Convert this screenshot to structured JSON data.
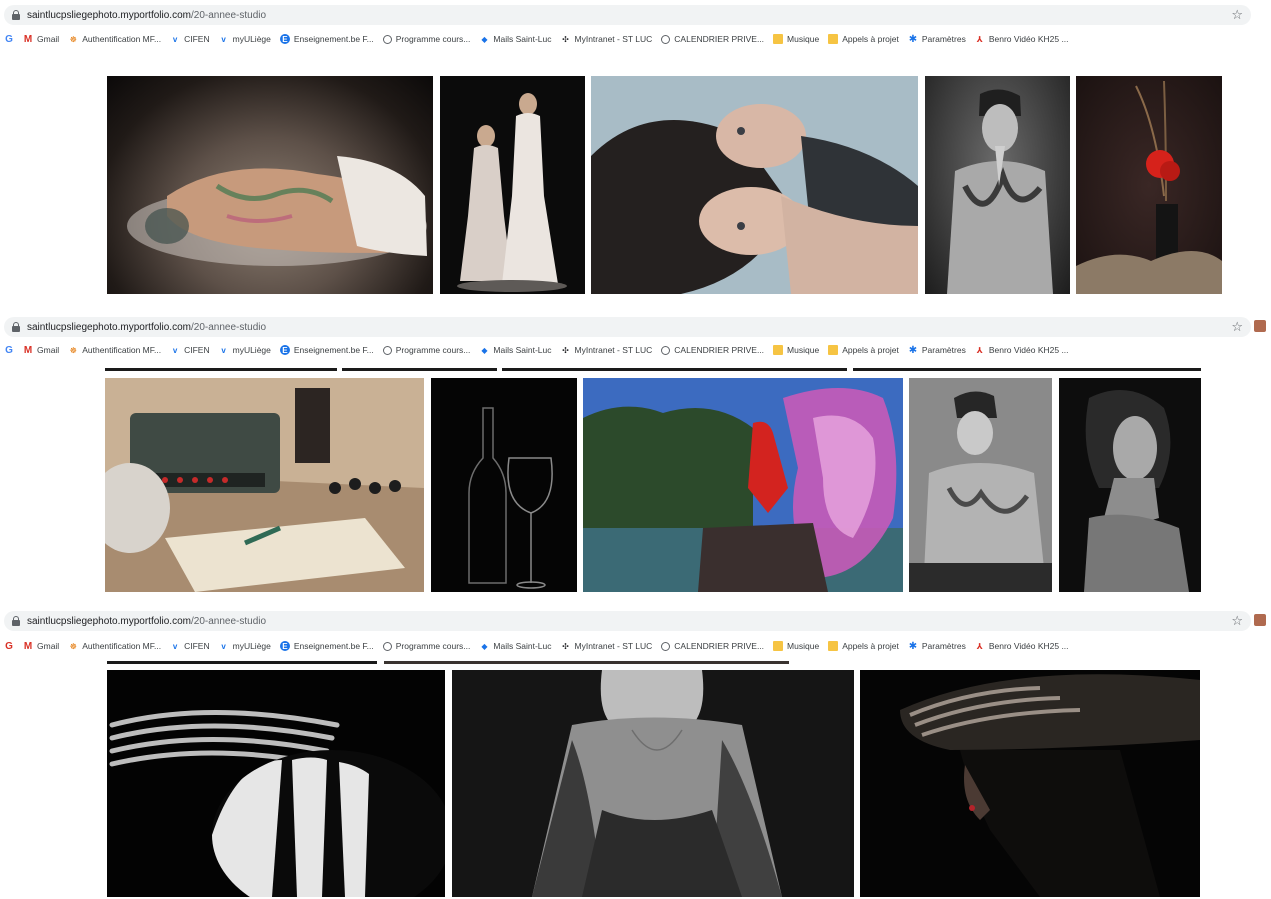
{
  "browser": {
    "url_host": "saintlucpsliegephoto.myportfolio.com",
    "url_path": "/20-annee-studio",
    "bookmarks": [
      {
        "label": "Gmail",
        "icon": "gmail-icon"
      },
      {
        "label": "Authentification MF...",
        "icon": "auth-icon"
      },
      {
        "label": "CIFEN",
        "icon": "uliege-icon"
      },
      {
        "label": "myULiège",
        "icon": "uliege-icon"
      },
      {
        "label": "Enseignement.be F...",
        "icon": "enseignement-icon"
      },
      {
        "label": "Programme cours...",
        "icon": "globe-icon"
      },
      {
        "label": "Mails Saint-Luc",
        "icon": "mail-icon"
      },
      {
        "label": "MyIntranet - ST LUC",
        "icon": "network-icon"
      },
      {
        "label": "CALENDRIER PRIVE...",
        "icon": "globe-icon"
      },
      {
        "label": "Musique",
        "icon": "folder-icon"
      },
      {
        "label": "Appels à projet",
        "icon": "folder-icon"
      },
      {
        "label": "Paramètres",
        "icon": "gear-icon"
      },
      {
        "label": "Benro Vidéo KH25 ...",
        "icon": "benro-icon"
      }
    ]
  },
  "screens": [
    {
      "photos": [
        "reclining-tattooed-figure",
        "two-women-white-dresses",
        "two-faces-lying",
        "tattooed-man-hand-face",
        "red-poppy-vase"
      ]
    },
    {
      "photos": [
        "typewriter-still-life",
        "wine-bottle-glass",
        "red-figure-pink-smoke",
        "tattooed-man-seated",
        "woman-portrait-bw"
      ]
    },
    {
      "photos": [
        "fork-striped-egg",
        "woman-lace-top",
        "woman-striped-hat"
      ]
    }
  ],
  "colors": {
    "address_bar": "#f1f3f4",
    "page_background": "#ffffff"
  }
}
